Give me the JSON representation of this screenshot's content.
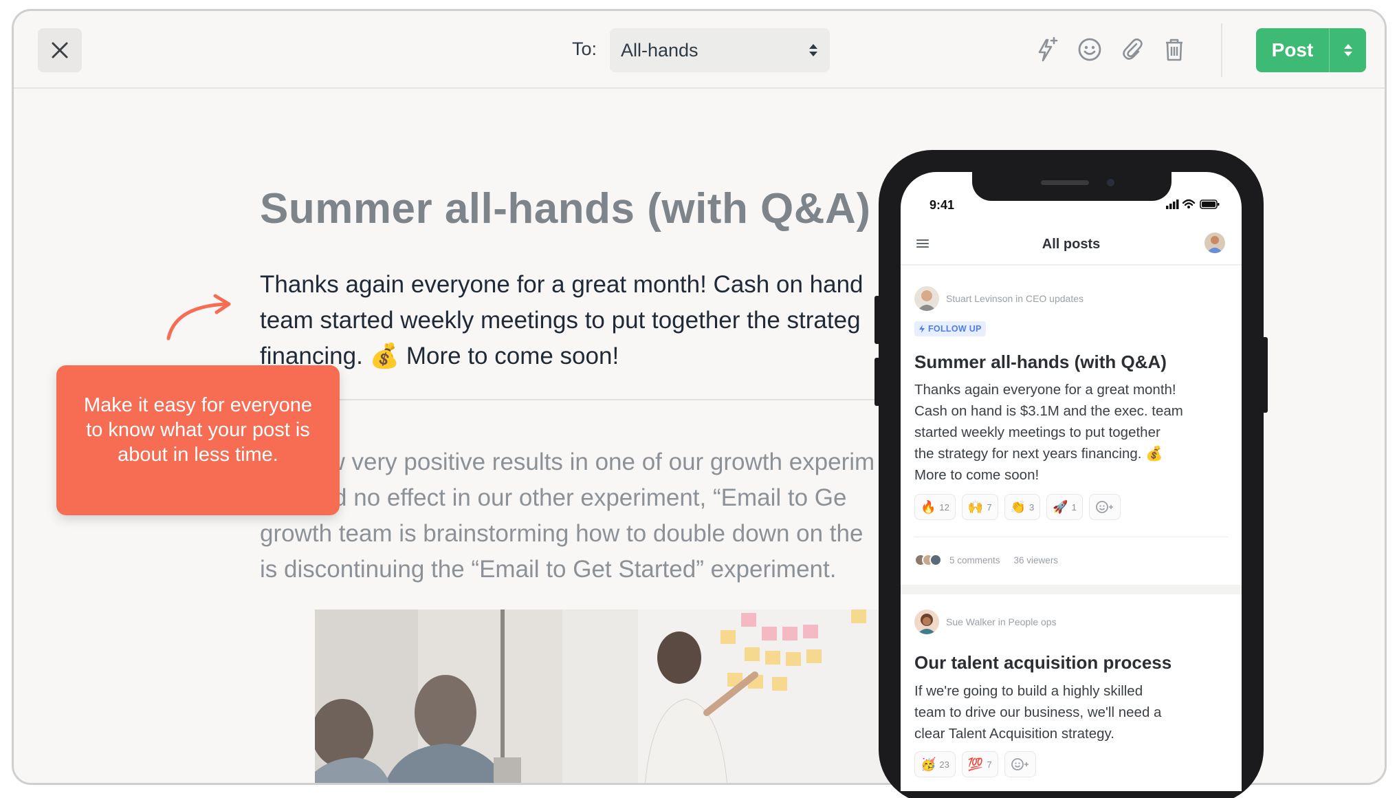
{
  "topbar": {
    "close_icon": "close-icon",
    "to_label": "To:",
    "to_value": "All-hands",
    "tools": [
      "sparkle-lightning-icon",
      "emoji-icon",
      "paperclip-icon",
      "trash-icon"
    ],
    "post_label": "Post"
  },
  "colors": {
    "post_button": "#3dbb74",
    "callout": "#f66d53",
    "follow_badge": "#4d7cf0"
  },
  "editor": {
    "title": "Summer all-hands (with Q&A)",
    "body_lines": [
      "Thanks again everyone for a great month! Cash on hand",
      "team started weekly meetings to put together the strateg",
      "financing. 💰 More to come soon!"
    ],
    "body2_lines": [
      "We saw very positive results in one of our growth experim",
      "and had no effect in our other experiment, “Email to Ge",
      "growth team is brainstorming how to double down on the",
      "is discontinuing the “Email to Get Started” experiment."
    ]
  },
  "callout": {
    "text": "Make it easy for everyone to know what your post is about in less time."
  },
  "phone": {
    "time": "9:41",
    "header_title": "All posts",
    "posts": [
      {
        "author": "Stuart Levinson in CEO updates",
        "badge": "FOLLOW UP",
        "title": "Summer all-hands (with Q&A)",
        "text_lines": [
          "Thanks again everyone for a great month!",
          "Cash on hand is $3.1M and the exec. team",
          "started weekly meetings to put together",
          "the strategy for next years financing. 💰",
          "More to come soon!"
        ],
        "reactions": [
          {
            "emoji": "🔥",
            "count": "12"
          },
          {
            "emoji": "🙌",
            "count": "7"
          },
          {
            "emoji": "👏",
            "count": "3"
          },
          {
            "emoji": "🚀",
            "count": "1"
          }
        ],
        "comments": "5 comments",
        "viewers": "36 viewers"
      },
      {
        "author": "Sue Walker in People ops",
        "title": "Our talent acquisition process",
        "text_lines": [
          "If we're going to build a highly skilled",
          "team to drive our business, we'll need a",
          "clear Talent Acquisition strategy."
        ],
        "reactions": [
          {
            "emoji": "🥳",
            "count": "23"
          },
          {
            "emoji": "💯",
            "count": "7"
          }
        ]
      }
    ]
  }
}
